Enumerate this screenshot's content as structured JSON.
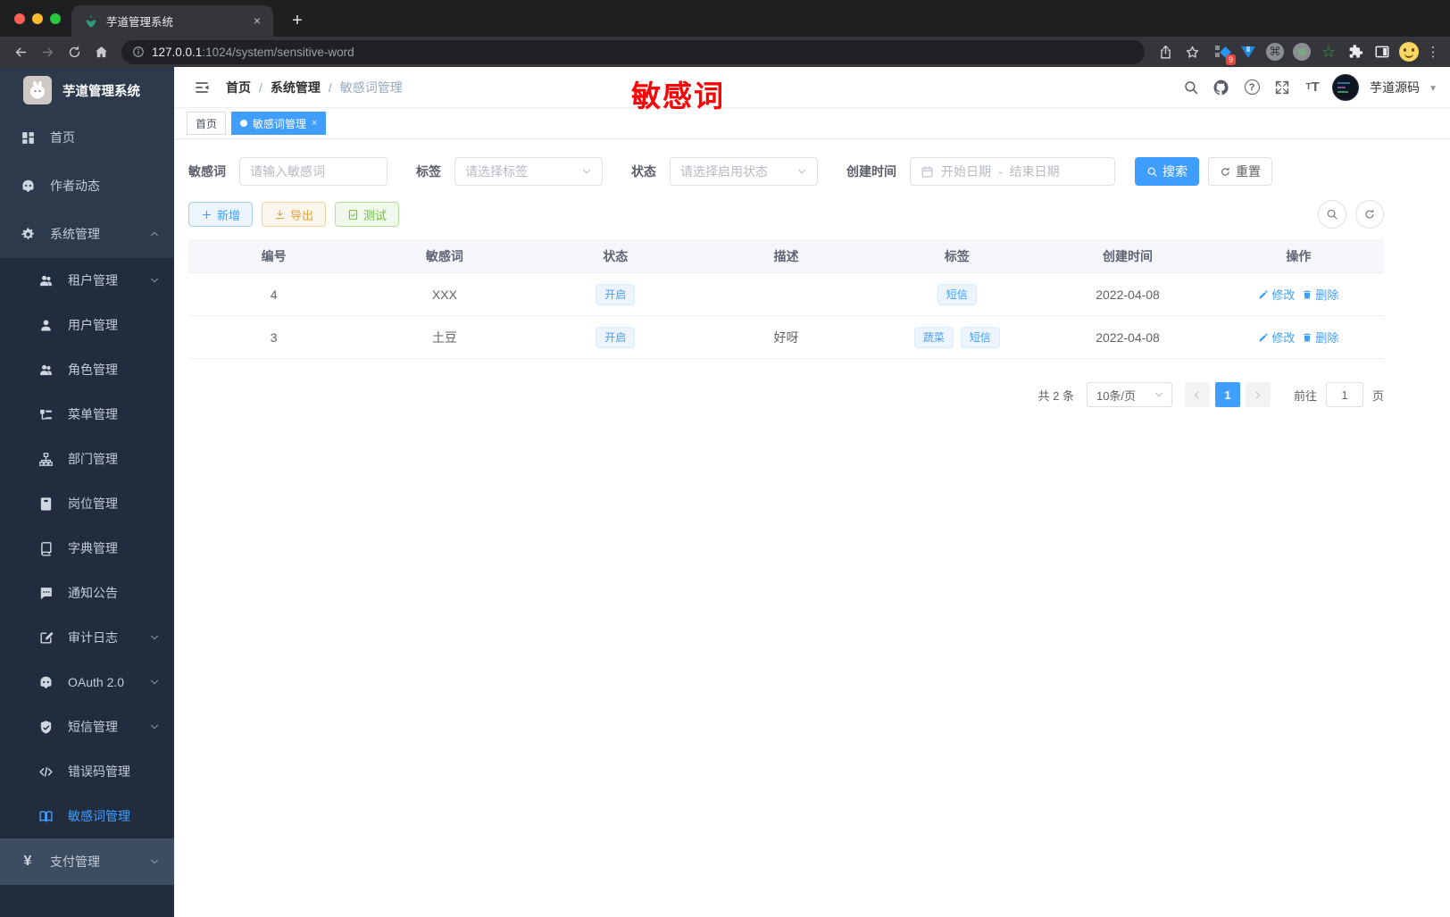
{
  "browser": {
    "tab_title": "芋道管理系统",
    "url_host": "127.0.0.1",
    "url_rest": ":1024/system/sensitive-word",
    "extension_badge": "9"
  },
  "sidebar": {
    "logo_title": "芋道管理系统",
    "items": [
      {
        "key": "home",
        "label": "首页",
        "icon": "dashboard-icon",
        "level": 1
      },
      {
        "key": "author-news",
        "label": "作者动态",
        "icon": "robot-chat-icon",
        "level": 1
      },
      {
        "key": "system",
        "label": "系统管理",
        "icon": "gear-icon",
        "level": 1,
        "chevron": "up"
      },
      {
        "key": "tenant",
        "label": "租户管理",
        "icon": "users-icon",
        "level": 2,
        "chevron": "down"
      },
      {
        "key": "user",
        "label": "用户管理",
        "icon": "user-icon",
        "level": 2
      },
      {
        "key": "role",
        "label": "角色管理",
        "icon": "users-icon",
        "level": 2
      },
      {
        "key": "menu",
        "label": "菜单管理",
        "icon": "tree-icon",
        "level": 2
      },
      {
        "key": "dept",
        "label": "部门管理",
        "icon": "org-icon",
        "level": 2
      },
      {
        "key": "post",
        "label": "岗位管理",
        "icon": "badge-icon",
        "level": 2
      },
      {
        "key": "dict",
        "label": "字典管理",
        "icon": "book-icon",
        "level": 2
      },
      {
        "key": "notice",
        "label": "通知公告",
        "icon": "message-icon",
        "level": 2
      },
      {
        "key": "audit-log",
        "label": "审计日志",
        "icon": "edit-log-icon",
        "level": 2,
        "chevron": "down"
      },
      {
        "key": "oauth2",
        "label": "OAuth 2.0",
        "icon": "robot-chat-icon",
        "level": 2,
        "chevron": "down"
      },
      {
        "key": "sms",
        "label": "短信管理",
        "icon": "shield-icon",
        "level": 2,
        "chevron": "down"
      },
      {
        "key": "error-code",
        "label": "错误码管理",
        "icon": "code-icon",
        "level": 2
      },
      {
        "key": "sensitive-word",
        "label": "敏感词管理",
        "icon": "open-book-icon",
        "level": 2,
        "active": true
      },
      {
        "key": "payment",
        "label": "支付管理",
        "icon": "yen-icon",
        "level": 1,
        "chevron": "down",
        "highlight": true
      }
    ]
  },
  "header": {
    "breadcrumb": [
      "首页",
      "系统管理",
      "敏感词管理"
    ],
    "annotation": "敏感词",
    "user_name": "芋道源码"
  },
  "tags": [
    {
      "label": "首页",
      "active": false
    },
    {
      "label": "敏感词管理",
      "active": true,
      "closable": true
    }
  ],
  "filters": {
    "keyword_label": "敏感词",
    "keyword_placeholder": "请输入敏感词",
    "tag_label": "标签",
    "tag_placeholder": "请选择标签",
    "status_label": "状态",
    "status_placeholder": "请选择启用状态",
    "date_label": "创建时间",
    "date_start_placeholder": "开始日期",
    "date_separator": "-",
    "date_end_placeholder": "结束日期",
    "search_label": "搜索",
    "reset_label": "重置"
  },
  "toolbar": {
    "add_label": "新增",
    "export_label": "导出",
    "test_label": "测试"
  },
  "table": {
    "columns": [
      "编号",
      "敏感词",
      "状态",
      "描述",
      "标签",
      "创建时间",
      "操作"
    ],
    "edit_label": "修改",
    "delete_label": "删除",
    "rows": [
      {
        "id": "4",
        "word": "XXX",
        "status": "开启",
        "desc": "",
        "tags": [
          "短信"
        ],
        "created": "2022-04-08"
      },
      {
        "id": "3",
        "word": "土豆",
        "status": "开启",
        "desc": "好呀",
        "tags": [
          "蔬菜",
          "短信"
        ],
        "created": "2022-04-08"
      }
    ]
  },
  "pagination": {
    "total": "共 2 条",
    "page_size": "10条/页",
    "current_page": "1",
    "goto_label": "前往",
    "goto_value": "1",
    "unit_label": "页"
  },
  "colors": {
    "primary": "#409eff",
    "sidebar_bg": "#2d3a4b",
    "submenu_bg": "#212d3e",
    "annotation_red": "#fa0505",
    "warning": "#e6a23c",
    "success": "#67c23a"
  }
}
